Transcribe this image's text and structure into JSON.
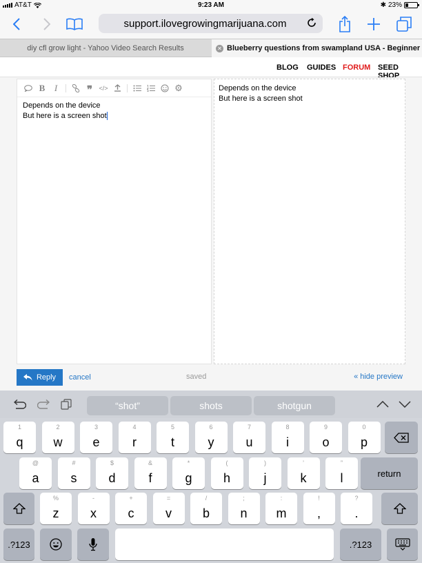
{
  "status_bar": {
    "carrier": "AT&T",
    "time": "9:23 AM",
    "battery": "23%"
  },
  "browser": {
    "url": "support.ilovegrowingmarijuana.com",
    "tabs": [
      {
        "title": "diy cfl grow light - Yahoo Video Search Results"
      },
      {
        "title": "Blueberry questions from swampland USA - Beginner -..."
      }
    ]
  },
  "site_nav": {
    "blog": "BLOG",
    "guides": "GUIDES",
    "forum": "FORUM",
    "seed_shop": "SEED SHOP"
  },
  "editor": {
    "lines": [
      "Depends on the device",
      "But here is a screen shot"
    ],
    "preview_lines": [
      "Depends on the device",
      "But here is a screen shot"
    ],
    "reply_label": "Reply",
    "cancel_label": "cancel",
    "saved_label": "saved",
    "hide_preview_label": "« hide preview"
  },
  "keyboard": {
    "suggestions": [
      "“shot”",
      "shots",
      "shotgun"
    ],
    "row1": [
      {
        "k": "q",
        "s": "1"
      },
      {
        "k": "w",
        "s": "2"
      },
      {
        "k": "e",
        "s": "3"
      },
      {
        "k": "r",
        "s": "4"
      },
      {
        "k": "t",
        "s": "5"
      },
      {
        "k": "y",
        "s": "6"
      },
      {
        "k": "u",
        "s": "7"
      },
      {
        "k": "i",
        "s": "8"
      },
      {
        "k": "o",
        "s": "9"
      },
      {
        "k": "p",
        "s": "0"
      }
    ],
    "row2": [
      {
        "k": "a",
        "s": "@"
      },
      {
        "k": "s",
        "s": "#"
      },
      {
        "k": "d",
        "s": "$"
      },
      {
        "k": "f",
        "s": "&"
      },
      {
        "k": "g",
        "s": "*"
      },
      {
        "k": "h",
        "s": "("
      },
      {
        "k": "j",
        "s": ")"
      },
      {
        "k": "k",
        "s": "’"
      },
      {
        "k": "l",
        "s": "”"
      }
    ],
    "row3": [
      {
        "k": "z",
        "s": "%"
      },
      {
        "k": "x",
        "s": "-"
      },
      {
        "k": "c",
        "s": "+"
      },
      {
        "k": "v",
        "s": "="
      },
      {
        "k": "b",
        "s": "/"
      },
      {
        "k": "n",
        "s": ";"
      },
      {
        "k": "m",
        "s": ":"
      },
      {
        "k": ",",
        "s": "!"
      },
      {
        "k": ".",
        "s": "?"
      }
    ],
    "return_label": "return",
    "numbers_label": ".?123"
  }
}
